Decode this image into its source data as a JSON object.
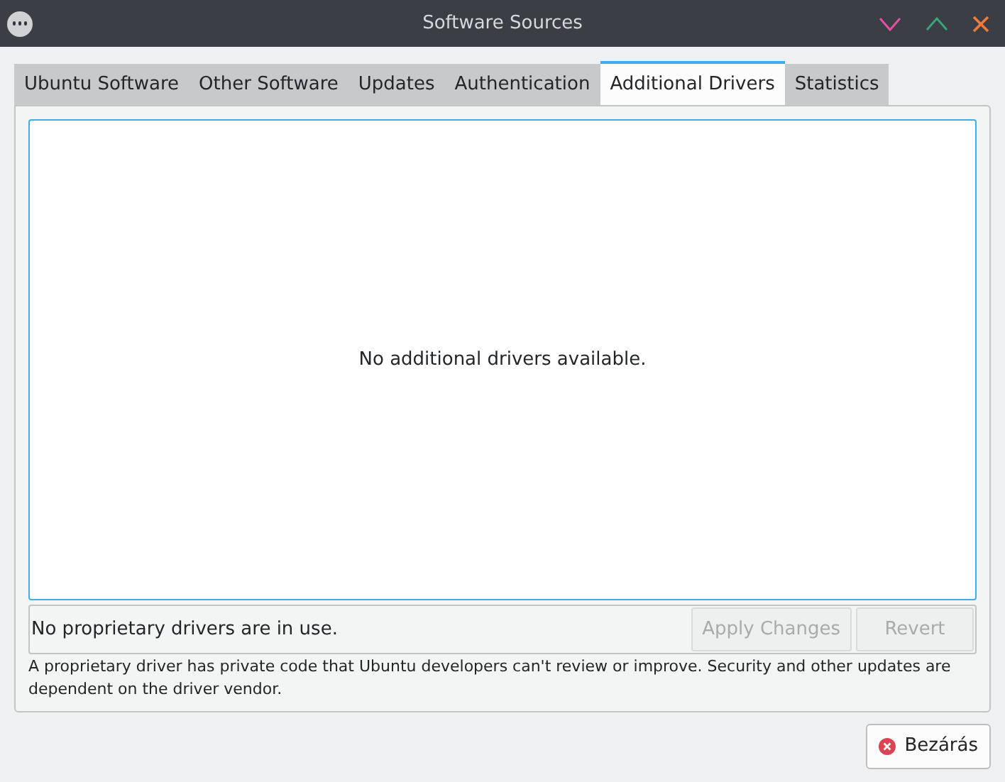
{
  "window": {
    "title": "Software Sources"
  },
  "tabs": [
    {
      "label": "Ubuntu Software",
      "selected": false
    },
    {
      "label": "Other Software",
      "selected": false
    },
    {
      "label": "Updates",
      "selected": false
    },
    {
      "label": "Authentication",
      "selected": false
    },
    {
      "label": "Additional Drivers",
      "selected": true
    },
    {
      "label": "Statistics",
      "selected": false
    }
  ],
  "drivers_list": {
    "empty_message": "No additional drivers available."
  },
  "status": {
    "text": "No proprietary drivers are in use.",
    "buttons": [
      {
        "label": "Apply Changes",
        "disabled": true
      },
      {
        "label": "Revert",
        "disabled": true
      }
    ]
  },
  "note": "A proprietary driver has private code that Ubuntu developers can't review or improve. Security and other updates are dependent on the driver vendor.",
  "close_button": {
    "label": "Bezárás"
  }
}
